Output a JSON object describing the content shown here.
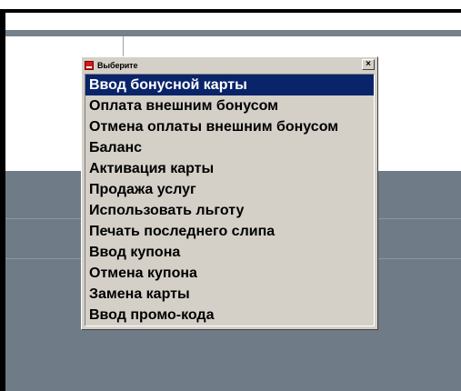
{
  "dialog": {
    "title": "Выберите",
    "close_symbol": "☒",
    "icon": "app-icon",
    "selected_index": 0,
    "items": [
      "Ввод бонусной карты",
      "Оплата внешним бонусом",
      "Отмена оплаты внешним бонусом",
      "Баланс",
      "Активация карты",
      "Продажа услуг",
      "Использовать льготу",
      "Печать последнего слипа",
      "Ввод купона",
      "Отмена купона",
      "Замена карты",
      "Ввод промо-кода"
    ]
  },
  "colors": {
    "selection": "#0a246a",
    "dialog_face": "#d4d0c8",
    "background_slate": "#6f7b86"
  }
}
